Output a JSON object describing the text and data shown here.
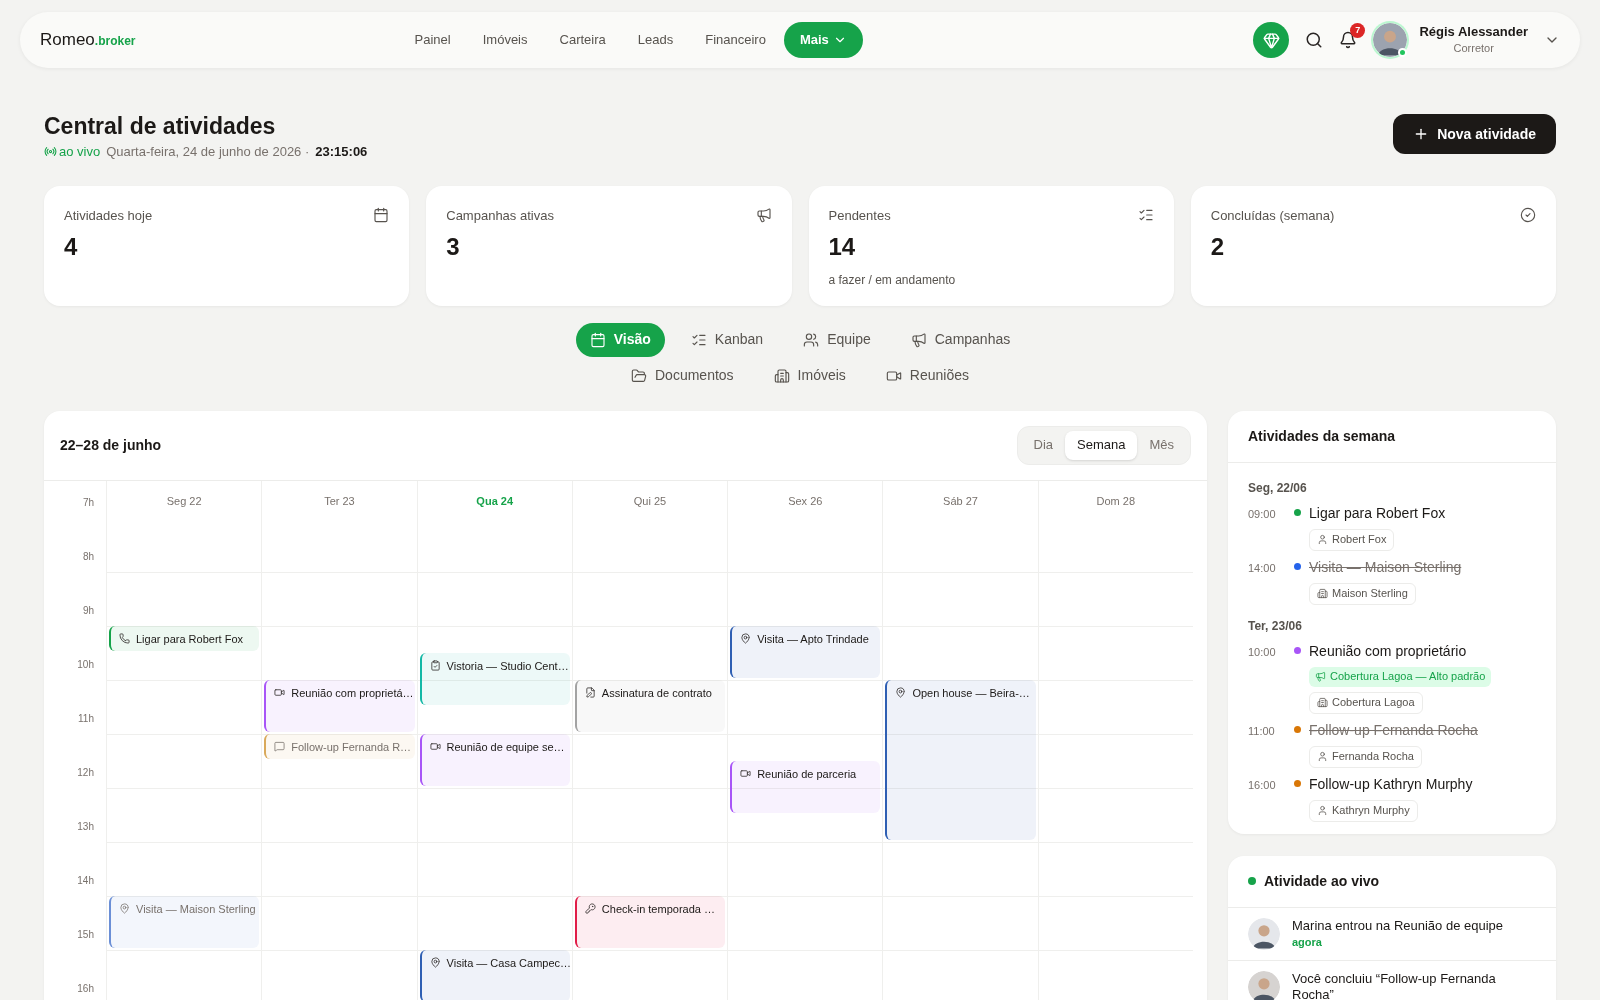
{
  "brand": {
    "name": "Romeo",
    "suffix": ".broker"
  },
  "nav": [
    {
      "label": "Painel",
      "selected": false
    },
    {
      "label": "Imóveis",
      "selected": false
    },
    {
      "label": "Carteira",
      "selected": false
    },
    {
      "label": "Leads",
      "selected": false
    },
    {
      "label": "Financeiro",
      "selected": false
    },
    {
      "label": "Mais",
      "selected": true
    }
  ],
  "notifications": {
    "count": "7"
  },
  "user": {
    "name": "Régis Alessander",
    "role": "Corretor",
    "online": true
  },
  "page": {
    "title": "Central de atividades",
    "live": "ao vivo",
    "date": "Quarta-feira, 24 de junho de 2026 ·",
    "time": "23:15:06",
    "action": "Nova atividade"
  },
  "stats": [
    {
      "kind": "calendar",
      "label": "Atividades hoje",
      "value": "4"
    },
    {
      "kind": "campaign",
      "label": "Campanhas ativas",
      "value": "3"
    },
    {
      "kind": "pending",
      "label": "Pendentes",
      "value": "14",
      "note": "a fazer / em andamento"
    },
    {
      "kind": "done",
      "label": "Concluídas (semana)",
      "value": "2"
    }
  ],
  "views": [
    [
      {
        "kind": "calendar",
        "label": "Visão",
        "selected": true
      },
      {
        "kind": "kanban",
        "label": "Kanban",
        "selected": false
      },
      {
        "kind": "team",
        "label": "Equipe",
        "selected": false
      },
      {
        "kind": "campaign",
        "label": "Campanhas",
        "selected": false
      }
    ],
    [
      {
        "kind": "documents",
        "label": "Documentos",
        "selected": false
      },
      {
        "kind": "property",
        "label": "Imóveis",
        "selected": false
      },
      {
        "kind": "meetings",
        "label": "Reuniões",
        "selected": false
      }
    ]
  ],
  "calendar": {
    "range": "22–28 de junho",
    "modes": [
      {
        "label": "Dia",
        "selected": false
      },
      {
        "label": "Semana",
        "selected": true
      },
      {
        "label": "Mês",
        "selected": false
      }
    ],
    "hours": [
      "7h",
      "8h",
      "9h",
      "10h",
      "11h",
      "12h",
      "13h",
      "14h",
      "15h",
      "16h"
    ],
    "days": [
      {
        "label": "Seg 22",
        "today": false,
        "events": [
          {
            "kind": "call",
            "title": "Ligar para Robert Fox",
            "color": "#16a34a",
            "done": false
          },
          {
            "kind": "visit",
            "title": "Visita — Maison Sterling",
            "color": "#6b8fd6",
            "done": true
          }
        ]
      },
      {
        "label": "Ter 23",
        "today": false,
        "events": [
          {
            "kind": "meeting",
            "title": "Reunião com proprietá…",
            "color": "#a855f7",
            "done": false
          },
          {
            "kind": "followup",
            "title": "Follow-up Fernanda R…",
            "color": "#d9a95b",
            "done": true
          }
        ]
      },
      {
        "label": "Qua 24",
        "today": true,
        "events": [
          {
            "kind": "inspection",
            "title": "Vistoria — Studio Cent…",
            "color": "#14b8a6",
            "done": false
          },
          {
            "kind": "meeting",
            "title": "Reunião de equipe se…",
            "color": "#a855f7",
            "done": false
          },
          {
            "kind": "visit",
            "title": "Visita — Casa Campec…",
            "color": "#2f5fb3",
            "done": false
          }
        ]
      },
      {
        "label": "Qui 25",
        "today": false,
        "events": [
          {
            "kind": "contract",
            "title": "Assinatura de contrato",
            "color": "#a3a3a3",
            "done": false
          },
          {
            "kind": "checkin",
            "title": "Check-in temporada …",
            "color": "#e11d48",
            "done": false
          }
        ]
      },
      {
        "label": "Sex 26",
        "today": false,
        "events": [
          {
            "kind": "visit",
            "title": "Visita — Apto Trindade",
            "color": "#2f5fb3",
            "done": false
          },
          {
            "kind": "meeting",
            "title": "Reunião de parceria",
            "color": "#a855f7",
            "done": false
          }
        ]
      },
      {
        "label": "Sáb 27",
        "today": false,
        "events": [
          {
            "kind": "visit",
            "title": "Open house — Beira-…",
            "color": "#2f5fb3",
            "done": false
          }
        ]
      },
      {
        "label": "Dom 28",
        "today": false
      }
    ]
  },
  "week": {
    "title": "Atividades da semana",
    "groups": [
      {
        "date": "Seg, 22/06",
        "items": [
          {
            "time": "09:00",
            "title": "Ligar para Robert Fox",
            "color": "#16a34a",
            "done": false,
            "tags": [
              {
                "kind": "person",
                "label": "Robert Fox"
              }
            ]
          },
          {
            "time": "14:00",
            "title": "Visita — Maison Sterling",
            "color": "#2563eb",
            "done": true,
            "tags": [
              {
                "kind": "property",
                "label": "Maison Sterling"
              }
            ]
          }
        ]
      },
      {
        "date": "Ter, 23/06",
        "items": [
          {
            "time": "10:00",
            "title": "Reunião com proprietário",
            "color": "#a855f7",
            "done": false,
            "tags": [
              {
                "kind": "campaign",
                "label": "Cobertura Lagoa — Alto padrão"
              },
              {
                "kind": "property",
                "label": "Cobertura Lagoa"
              }
            ]
          },
          {
            "time": "11:00",
            "title": "Follow-up Fernanda Rocha",
            "color": "#d97706",
            "done": true,
            "tags": [
              {
                "kind": "person",
                "label": "Fernanda Rocha"
              }
            ]
          },
          {
            "time": "16:00",
            "title": "Follow-up Kathryn Murphy",
            "color": "#d97706",
            "done": false,
            "tags": [
              {
                "kind": "person",
                "label": "Kathryn Murphy"
              }
            ]
          }
        ]
      }
    ]
  },
  "live": {
    "title": "Atividade ao vivo",
    "items": [
      {
        "text": "Marina entrou na Reunião de equipe",
        "time": "agora"
      },
      {
        "text": "Você concluiu “Follow-up Fernanda Rocha”"
      }
    ]
  }
}
